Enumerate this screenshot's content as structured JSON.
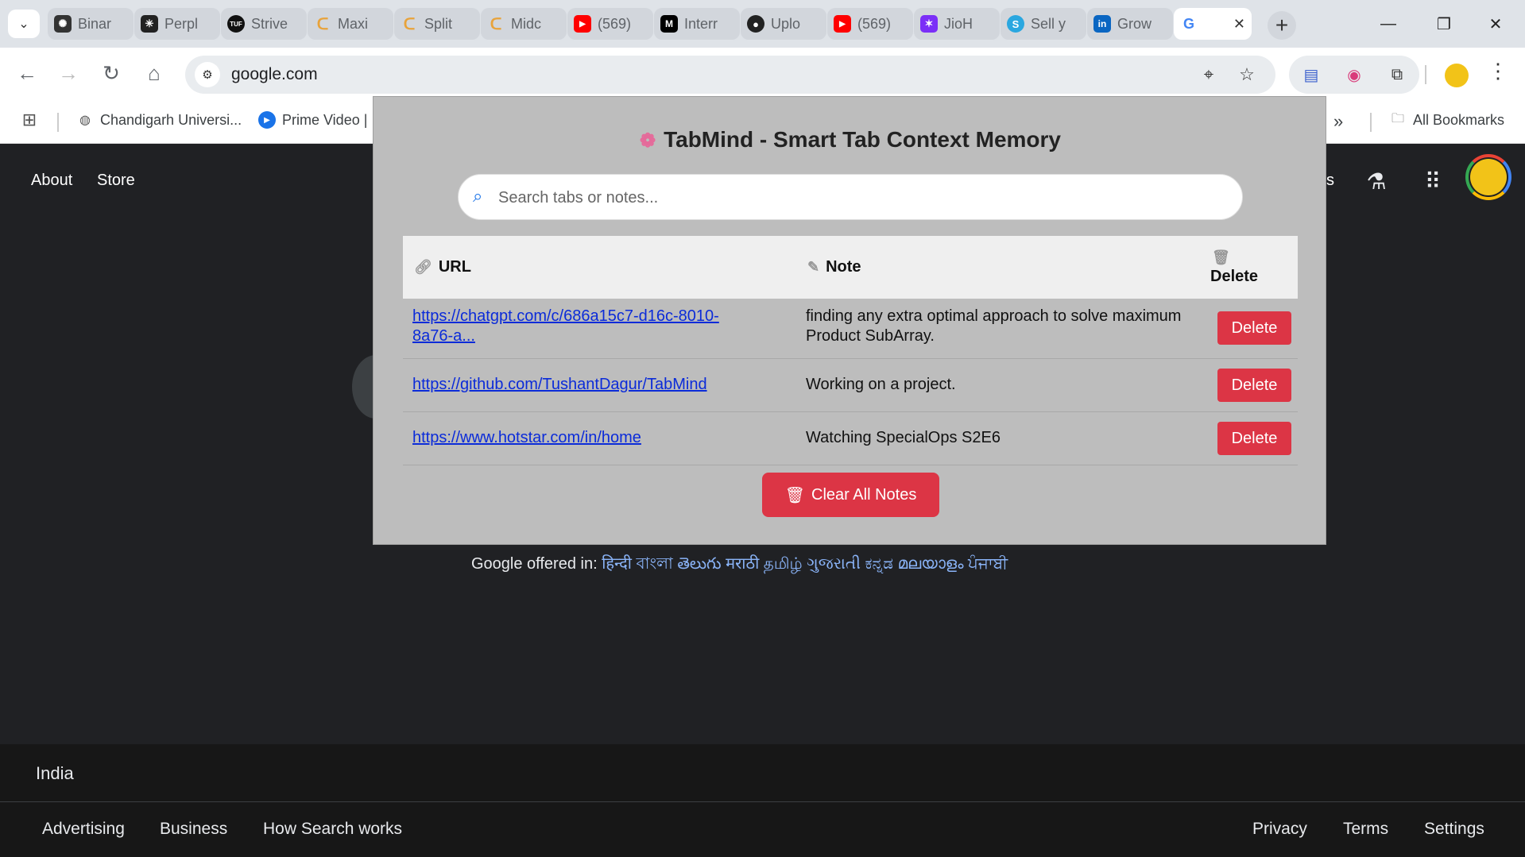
{
  "browser": {
    "tabs": [
      {
        "title": "Binar",
        "icon": "chatgpt-icon",
        "color": "#333333"
      },
      {
        "title": "Perpl",
        "icon": "perplexity-icon",
        "color": "#222222"
      },
      {
        "title": "Strive",
        "icon": "tuf-icon",
        "color": "#111111"
      },
      {
        "title": "Maxi",
        "icon": "leetcode-icon",
        "color": "#e8a33b"
      },
      {
        "title": "Split",
        "icon": "leetcode-icon",
        "color": "#e8a33b"
      },
      {
        "title": "Midc",
        "icon": "leetcode-icon",
        "color": "#e8a33b"
      },
      {
        "title": "(569)",
        "icon": "youtube-icon",
        "color": "#ff0000"
      },
      {
        "title": "Interr",
        "icon": "medium-icon",
        "color": "#000000"
      },
      {
        "title": "Uplo",
        "icon": "github-icon",
        "color": "#222222"
      },
      {
        "title": "(569)",
        "icon": "youtube-icon",
        "color": "#ff0000"
      },
      {
        "title": "JioH",
        "icon": "jiohotstar-icon",
        "color": "#7b2ff7"
      },
      {
        "title": "Sell y",
        "icon": "s-app-icon",
        "color": "#2aa7e0"
      },
      {
        "title": "Grow",
        "icon": "linkedin-icon",
        "color": "#0a66c2"
      },
      {
        "title": "G",
        "icon": "google-icon",
        "color": "#4285f4"
      }
    ],
    "address": "google.com",
    "bookmarks": [
      {
        "label": "Chandigarh Universi..."
      },
      {
        "label": "Prime Video |"
      }
    ],
    "all_bookmarks": "All Bookmarks"
  },
  "google": {
    "nav": {
      "about": "About",
      "store": "Store",
      "partial": "s"
    },
    "offered_prefix": "Google offered in:",
    "offered_langs": "हिन्दी বাংলা తెలుగు मराठी தமிழ் ગુજરાતી ಕನ್ನಡ മലയാളം ਪੰਜਾਬੀ",
    "country": "India",
    "footer_left": [
      "Advertising",
      "Business",
      "How Search works"
    ],
    "footer_right": [
      "Privacy",
      "Terms",
      "Settings"
    ]
  },
  "popup": {
    "title": "TabMind - Smart Tab Context Memory",
    "search_placeholder": "Search tabs or notes...",
    "headers": {
      "url": "URL",
      "note": "Note",
      "delete": "Delete"
    },
    "rows": [
      {
        "url_line1": "https://chatgpt.com/c/686a15c7-d16c-8010-",
        "url_line2": "8a76-a...",
        "note_line1": "finding any extra optimal approach to solve maximum",
        "note_line2": "Product SubArray.",
        "delete": "Delete"
      },
      {
        "url_line1": "https://github.com/TushantDagur/TabMind",
        "url_line2": "",
        "note_line1": "Working on a project.",
        "note_line2": "",
        "delete": "Delete"
      },
      {
        "url_line1": "https://www.hotstar.com/in/home",
        "url_line2": "",
        "note_line1": "Watching SpecialOps S2E6",
        "note_line2": "",
        "delete": "Delete"
      }
    ],
    "clear_all": "Clear All Notes",
    "colors": {
      "danger": "#dc3545",
      "link": "#0b2bd9"
    }
  }
}
